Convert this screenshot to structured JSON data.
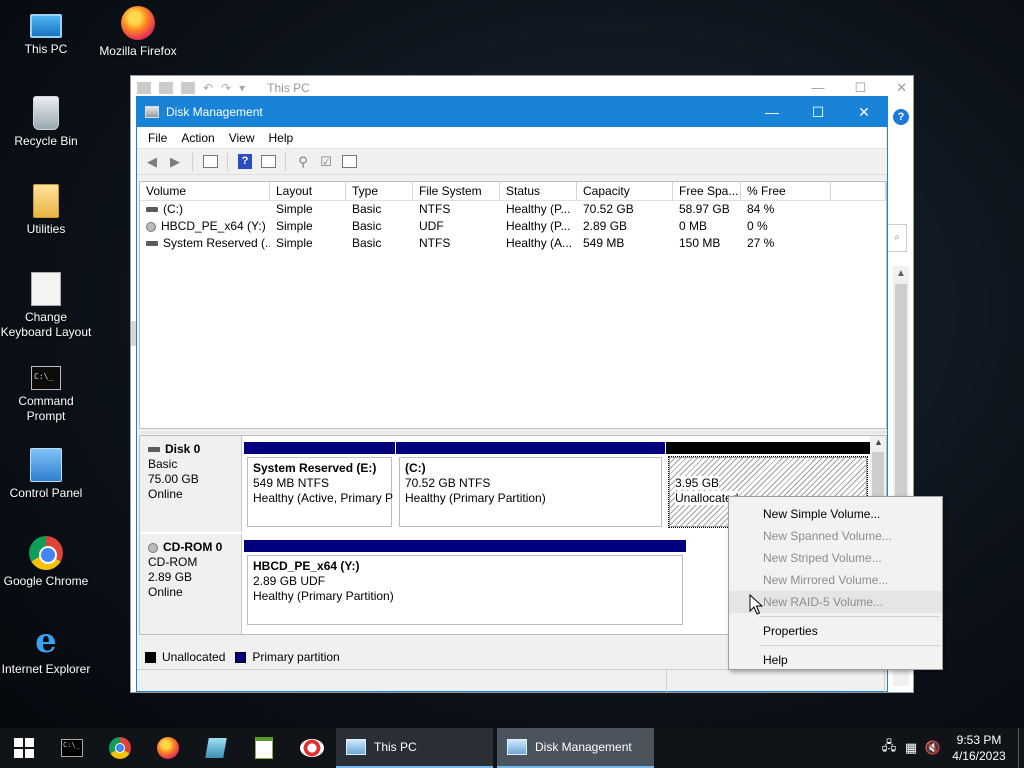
{
  "desktop": {
    "icons": [
      {
        "label": "This PC"
      },
      {
        "label": "Mozilla Firefox"
      },
      {
        "label": "Recycle Bin"
      },
      {
        "label": "Utilities"
      },
      {
        "label": "Change Keyboard Layout"
      },
      {
        "label": "Command Prompt"
      },
      {
        "label": "Control Panel"
      },
      {
        "label": "Google Chrome"
      },
      {
        "label": "Internet Explorer"
      }
    ]
  },
  "explorer": {
    "title": "This PC",
    "help": "?",
    "cmd_glyph": "C:\\_"
  },
  "disk_management": {
    "title": "Disk Management",
    "menu": [
      "File",
      "Action",
      "View",
      "Help"
    ],
    "volume_columns": [
      "Volume",
      "Layout",
      "Type",
      "File System",
      "Status",
      "Capacity",
      "Free Spa...",
      "% Free"
    ],
    "volumes": [
      {
        "volume": "(C:)",
        "layout": "Simple",
        "type": "Basic",
        "fs": "NTFS",
        "status": "Healthy (P...",
        "capacity": "70.52 GB",
        "free": "58.97 GB",
        "pct": "84 %"
      },
      {
        "volume": "HBCD_PE_x64 (Y:)",
        "layout": "Simple",
        "type": "Basic",
        "fs": "UDF",
        "status": "Healthy (P...",
        "capacity": "2.89 GB",
        "free": "0 MB",
        "pct": "0 %"
      },
      {
        "volume": "System Reserved (...",
        "layout": "Simple",
        "type": "Basic",
        "fs": "NTFS",
        "status": "Healthy (A...",
        "capacity": "549 MB",
        "free": "150 MB",
        "pct": "27 %"
      }
    ],
    "disks": [
      {
        "name": "Disk 0",
        "kind": "Basic",
        "size": "75.00 GB",
        "state": "Online",
        "partitions": [
          {
            "name": "System Reserved  (E:)",
            "size": "549 MB NTFS",
            "status": "Healthy (Active, Primary P"
          },
          {
            "name": "(C:)",
            "size": "70.52 GB NTFS",
            "status": "Healthy (Primary Partition)"
          },
          {
            "name": "",
            "size": "3.95 GB",
            "status": "Unallocated"
          }
        ]
      },
      {
        "name": "CD-ROM 0",
        "kind": "CD-ROM",
        "size": "2.89 GB",
        "state": "Online",
        "partitions": [
          {
            "name": "HBCD_PE_x64  (Y:)",
            "size": "2.89 GB UDF",
            "status": "Healthy (Primary Partition)"
          }
        ]
      }
    ],
    "legend": [
      {
        "label": "Unallocated",
        "color": "#000000"
      },
      {
        "label": "Primary partition",
        "color": "#00007f"
      }
    ]
  },
  "context_menu": {
    "items": [
      {
        "label": "New Simple Volume...",
        "enabled": true
      },
      {
        "label": "New Spanned Volume...",
        "enabled": false
      },
      {
        "label": "New Striped Volume...",
        "enabled": false
      },
      {
        "label": "New Mirrored Volume...",
        "enabled": false
      },
      {
        "label": "New RAID-5 Volume...",
        "enabled": false
      },
      {
        "label": "Properties",
        "enabled": true
      },
      {
        "label": "Help",
        "enabled": true
      }
    ]
  },
  "taskbar": {
    "tasks": [
      {
        "label": "This PC"
      },
      {
        "label": "Disk Management"
      }
    ],
    "clock": {
      "time": "9:53 PM",
      "date": "4/16/2023"
    }
  },
  "colors": {
    "titlebar": "#1883d7",
    "primary_partition": "#00007f",
    "unallocated": "#000000",
    "taskbar": "#101419"
  }
}
